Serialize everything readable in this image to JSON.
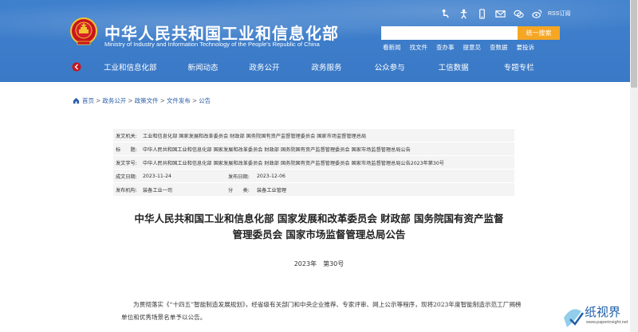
{
  "header": {
    "title": "中华人民共和国工业和信息化部",
    "subtitle": "Ministry of Industry and Information Technology of the People's Republic of China",
    "rss_label": "RSS订阅",
    "search_placeholder": "",
    "search_button": "统一搜索",
    "quicklinks": [
      "看新闻",
      "找文件",
      "查办事",
      "提意见",
      "查数据",
      "要投诉"
    ],
    "nav": [
      "工业和信息化部",
      "新闻动态",
      "政务公开",
      "政务服务",
      "公众参与",
      "工信数据",
      "专题专栏"
    ],
    "colors": {
      "bar": "#3d7cc9",
      "search_button": "#f5a623"
    }
  },
  "breadcrumb": {
    "items": [
      "首页",
      "政务公开",
      "政策文件",
      "文件发布",
      "公告"
    ],
    "separator": ">"
  },
  "info": {
    "issuer_label": "发文机关:",
    "issuer_value": "工业和信息化部 国家发展和改革委员会 财政部 国务院国有资产监督管理委员会 国家市场监督管理总局",
    "title_label": "标　　题:",
    "title_value": "中华人民共和国工业和信息化部 国家发展和改革委员会 财政部 国务院国有资产监督管理委员会 国家市场监督管理总局公告",
    "docno_label": "发文字号:",
    "docno_value": "中华人民共和国工业和信息化部 国家发展和改革委员会 财政部 国务院国有资产监督管理委员会 国家市场监督管理总局公告2023年第30号",
    "created_label": "成文日期:",
    "created_value": "2023-11-24",
    "published_label": "发布日期:",
    "published_value": "2023-12-06",
    "org_label": "发布机构:",
    "org_value": "装备工业一司",
    "category_label": "分　　类:",
    "category_value": "装备工业管理"
  },
  "document": {
    "title_line1": "中华人民共和国工业和信息化部 国家发展和改革委员会 财政部 国务院国有资产监督",
    "title_line2": "管理委员会 国家市场监督管理总局公告",
    "number": "2023年　第30号",
    "body": "为贯彻落实《“十四五”智能制造发展规划》，经省级有关部门和中央企业推荐、专家评审、网上公示等程序，现将2023年度智能制造示范工厂揭榜单位和优秀场景名单予以公告。"
  },
  "watermark": {
    "text": "纸视界",
    "url": "www.paperinsight.net"
  },
  "icons": [
    "wheelchair-icon",
    "accessibility-icon",
    "mobile-icon",
    "mail-icon",
    "wechat-icon",
    "weibo-icon",
    "home-icon",
    "back-arrow-icon"
  ]
}
